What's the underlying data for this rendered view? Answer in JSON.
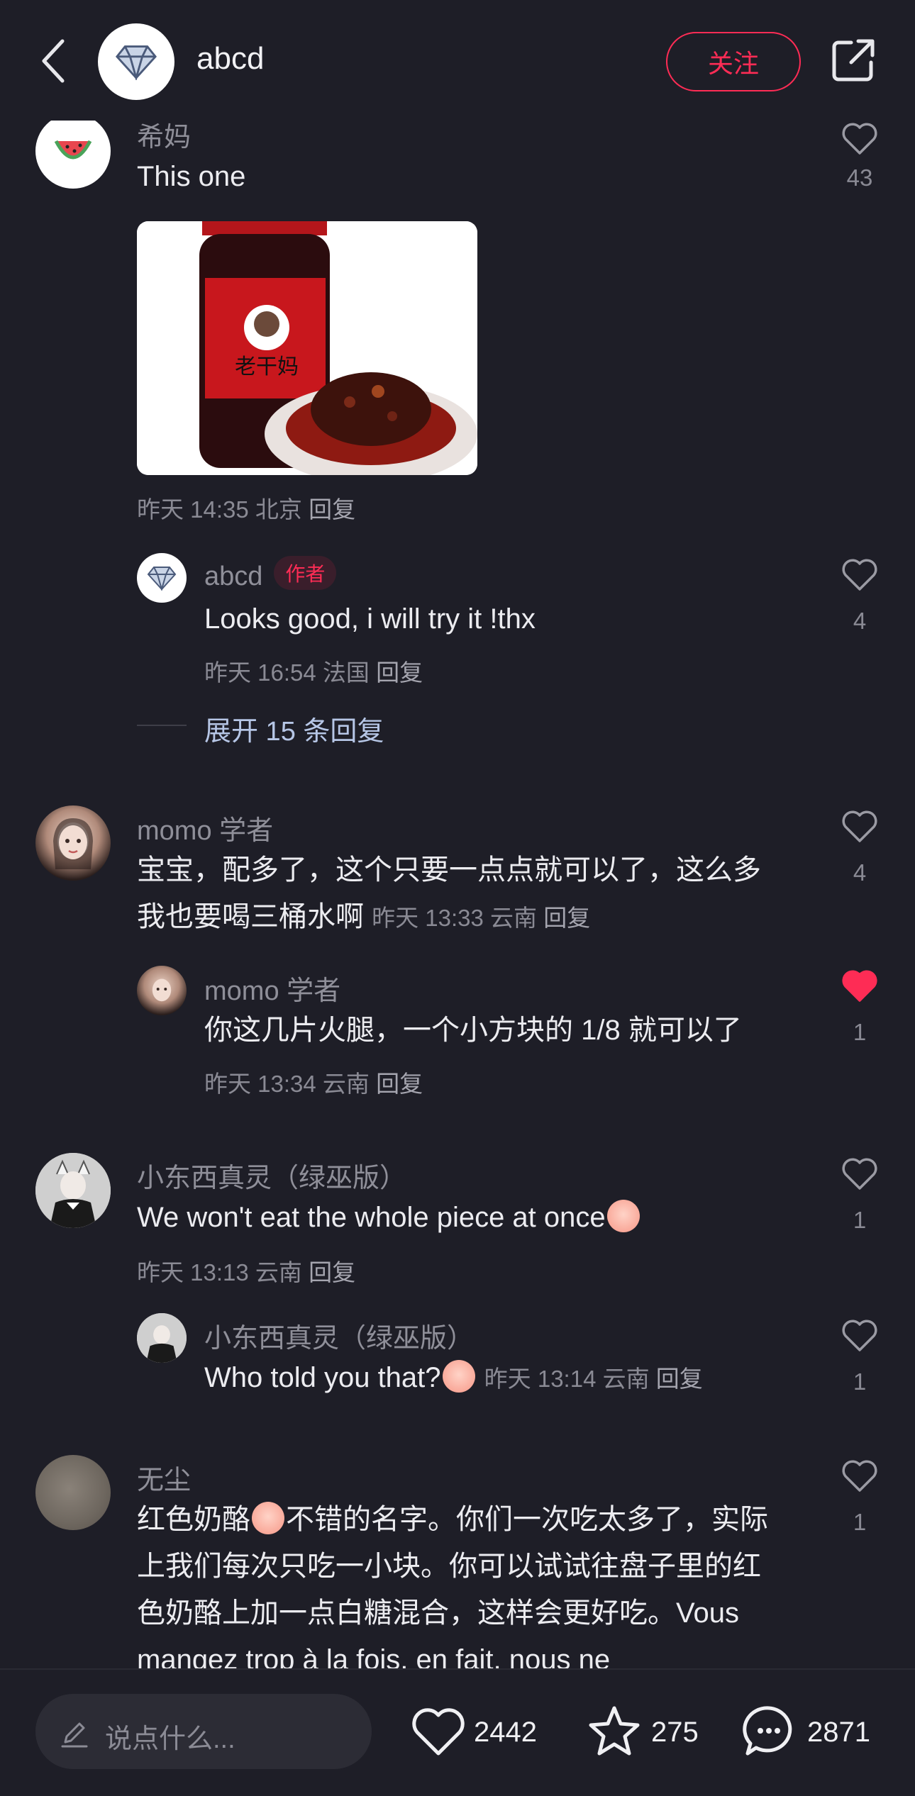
{
  "header": {
    "title": "abcd",
    "follow_label": "关注"
  },
  "comments": [
    {
      "user": "希妈",
      "text": "This one",
      "likes": "43",
      "time": "昨天 14:35 北京",
      "reply_label": "回复",
      "photo_label": "老干妈",
      "reply": {
        "user": "abcd",
        "badge": "作者",
        "text": "Looks good, i will try it !thx",
        "time": "昨天 16:54 法国",
        "reply_label": "回复",
        "likes": "4"
      },
      "expand_label": "展开 15 条回复"
    },
    {
      "user": "momo 学者",
      "text_line1": "宝宝，配多了，这个只要一点点就可以了，这么多",
      "text_line2": "我也要喝三桶水啊",
      "time": "昨天 13:33 云南",
      "reply_label": "回复",
      "likes": "4",
      "reply": {
        "user": "momo 学者",
        "text": "你这几片火腿，一个小方块的 1/8 就可以了",
        "time": "昨天 13:34 云南",
        "reply_label": "回复",
        "likes": "1"
      }
    },
    {
      "user": "小东西真灵（绿巫版）",
      "text": "We won't eat the whole piece at once",
      "time": "昨天 13:13 云南",
      "reply_label": "回复",
      "likes": "1",
      "reply": {
        "user": "小东西真灵（绿巫版）",
        "text": "Who told you that?",
        "time": "昨天 13:14 云南",
        "reply_label": "回复",
        "likes": "1"
      }
    },
    {
      "user": "无尘",
      "line1_a": "红色奶酪",
      "line1_b": "不错的名字。你们一次吃太多了，实际",
      "line2": "上我们每次只吃一小块。你可以试试往盘子里的红",
      "line3": "色奶酪上加一点白糖混合，这样会更好吃。Vous",
      "line4": "mangez trop à la fois, en fait, nous ne",
      "likes": "1"
    }
  ],
  "bottom_bar": {
    "input_placeholder": "说点什么...",
    "likes": "2442",
    "favorites": "275",
    "comments": "2871"
  },
  "colors": {
    "background": "#1e1e27",
    "accent": "#fe2c55",
    "liked": "#fe2c55"
  }
}
